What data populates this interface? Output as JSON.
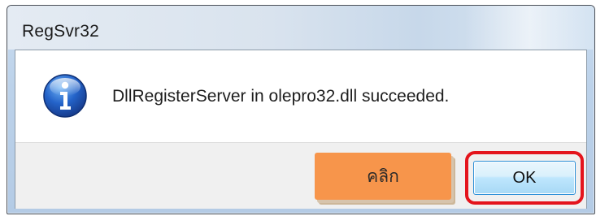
{
  "window": {
    "title": "RegSvr32"
  },
  "dialog": {
    "icon": "info-icon",
    "message": "DllRegisterServer in olepro32.dll succeeded."
  },
  "annotation": {
    "label": "คลิก",
    "label_color": "#f7954b",
    "highlight_color": "#e4141c"
  },
  "buttons": {
    "ok_label": "OK"
  }
}
